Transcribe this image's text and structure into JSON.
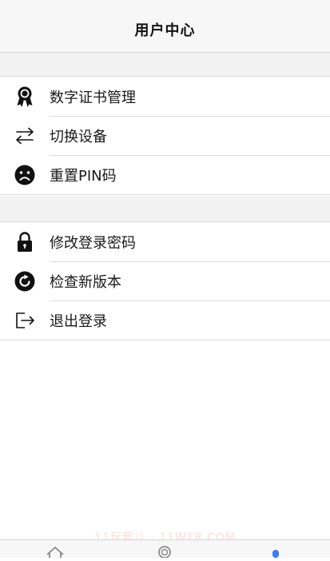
{
  "header": {
    "title": "用户中心"
  },
  "groups": [
    {
      "items": [
        {
          "label": "数字证书管理",
          "icon": "certificate-icon"
        },
        {
          "label": "切换设备",
          "icon": "switch-arrows-icon"
        },
        {
          "label": "重置PIN码",
          "icon": "sad-face-icon"
        }
      ]
    },
    {
      "items": [
        {
          "label": "修改登录密码",
          "icon": "lock-icon"
        },
        {
          "label": "检查新版本",
          "icon": "refresh-icon"
        },
        {
          "label": "退出登录",
          "icon": "logout-icon"
        }
      ]
    }
  ],
  "tabbar": {
    "tabs": [
      {
        "icon": "home-icon",
        "active": false
      },
      {
        "icon": "circle-icon",
        "active": false
      },
      {
        "icon": "user-icon",
        "active": true
      }
    ],
    "active_color": "#3d7bf2",
    "inactive_color": "#8a8a8a"
  },
  "watermark": {
    "text": "11玩套儿 · 11WTR.COM"
  }
}
